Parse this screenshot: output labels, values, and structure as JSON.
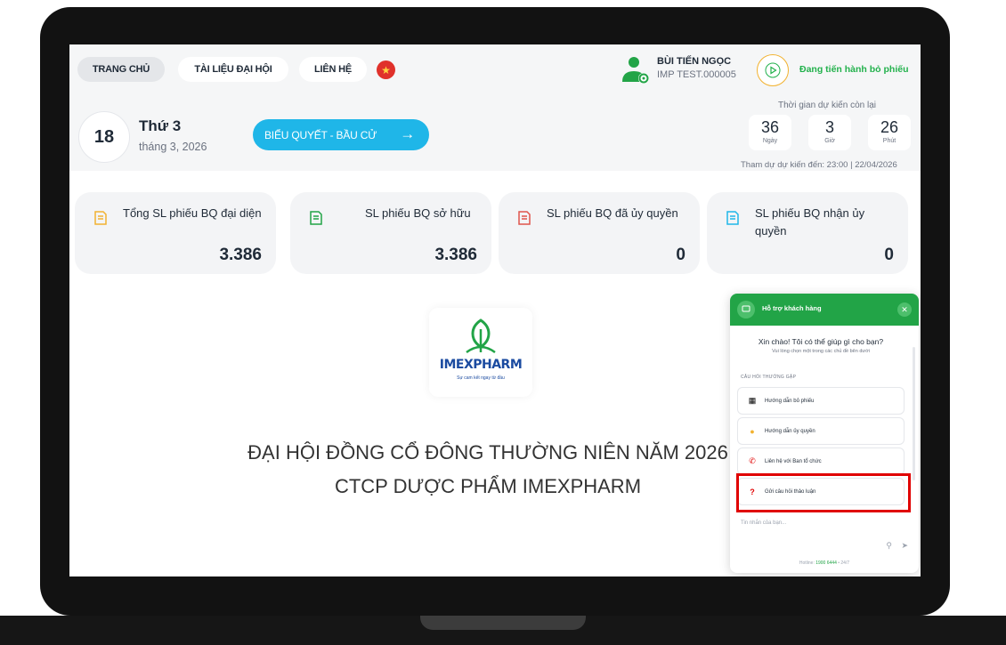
{
  "nav": {
    "home": "TRANG CHỦ",
    "docs": "TÀI LIỆU ĐẠI HỘI",
    "contact": "LIÊN HỆ",
    "flag_icon": "vietnam-flag-icon"
  },
  "user": {
    "name": "BÙI TIẾN NGỌC",
    "code": "IMP TEST.000005",
    "avatar_icon": "user-settings-icon",
    "voting_status": "Đang tiến hành bỏ phiếu",
    "voting_icon": "play-icon"
  },
  "date": {
    "day": "18",
    "weekday": "Thứ 3",
    "month": "tháng 3, 2026"
  },
  "vote_button": {
    "label": "BIỂU QUYẾT - BẦU CỬ",
    "arrow": "→"
  },
  "countdown": {
    "title": "Thời gian dự kiến còn lại",
    "days": "36",
    "days_label": "Ngày",
    "hours": "3",
    "hours_label": "Giờ",
    "minutes": "26",
    "minutes_label": "Phút",
    "deadline": "Tham dự dự kiến đến: 23:00 | 22/04/2026"
  },
  "stats": [
    {
      "label": "Tổng SL phiếu BQ đại diện",
      "value": "3.386"
    },
    {
      "label": "SL phiếu BQ sở hữu",
      "value": "3.386"
    },
    {
      "label": "SL phiếu BQ đã ủy quyền",
      "value": "0"
    },
    {
      "label": "SL phiếu BQ nhận ủy quyền",
      "value": "0"
    }
  ],
  "logo": {
    "brand": "IMEXPHARM",
    "tagline": "Sự cam kết ngay từ đầu"
  },
  "headline": {
    "line1": "ĐẠI HỘI ĐỒNG CỔ ĐÔNG THƯỜNG NIÊN NĂM 2026",
    "line2": "CTCP DƯỢC PHẨM IMEXPHARM"
  },
  "chat": {
    "title": "Hỗ trợ khách hàng",
    "greeting": "Xin chào! Tôi có thể giúp gì cho bạn?",
    "subtitle": "Vui lòng chọn một trong các chủ đề bên dưới",
    "faq_title": "CÂU HỎI THƯỜNG GẶP",
    "items": [
      {
        "label": "Hướng dẫn bỏ phiếu",
        "icon": "ballot-icon"
      },
      {
        "label": "Hướng dẫn ủy quyền",
        "icon": "handshake-icon"
      },
      {
        "label": "Liên hệ với Ban tổ chức",
        "icon": "phone-icon"
      },
      {
        "label": "Gửi câu hỏi thảo luận",
        "icon": "question-icon"
      }
    ],
    "input_placeholder": "Tin nhắn của bạn...",
    "footer_prefix": "Hotline:",
    "hotline": "1900 6444",
    "footer_suffix": "• 24/7"
  },
  "colors": {
    "accent_blue": "#1fb6e8",
    "accent_green": "#22a447",
    "highlight_red": "#e00000"
  }
}
